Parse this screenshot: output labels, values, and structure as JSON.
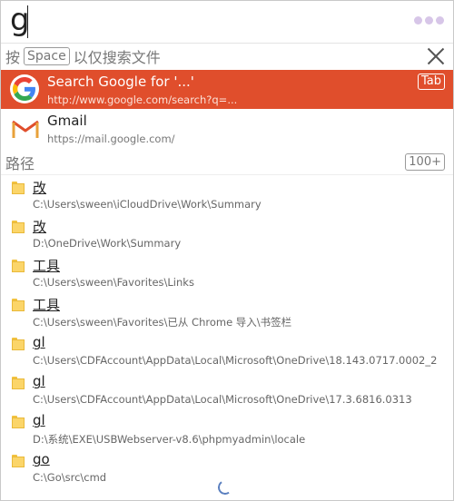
{
  "search": {
    "query": "g"
  },
  "hint": {
    "prefix": "按",
    "key": "Space",
    "suffix": "以仅搜索文件"
  },
  "results": [
    {
      "title": "Search Google for '...'",
      "url": "http://www.google.com/search?q=...",
      "shortcut": "Tab",
      "icon": "google-icon"
    },
    {
      "title": "Gmail",
      "url": "https://mail.google.com/",
      "icon": "gmail-icon"
    }
  ],
  "paths_section": {
    "title": "路径",
    "count": "100+"
  },
  "paths": [
    {
      "name": "改",
      "path": "C:\\Users\\sween\\iCloudDrive\\Work\\Summary"
    },
    {
      "name": "改",
      "path": "D:\\OneDrive\\Work\\Summary"
    },
    {
      "name": "工具",
      "path": "C:\\Users\\sween\\Favorites\\Links"
    },
    {
      "name": "工具",
      "path": "C:\\Users\\sween\\Favorites\\已从 Chrome 导入\\书签栏"
    },
    {
      "name": "gl",
      "path": "C:\\Users\\CDFAccount\\AppData\\Local\\Microsoft\\OneDrive\\18.143.0717.0002_2"
    },
    {
      "name": "gl",
      "path": "C:\\Users\\CDFAccount\\AppData\\Local\\Microsoft\\OneDrive\\17.3.6816.0313"
    },
    {
      "name": "gl",
      "path": "D:\\系统\\EXE\\USBWebserver-v8.6\\phpmyadmin\\locale"
    },
    {
      "name": "go",
      "path": "C:\\Go\\src\\cmd"
    }
  ],
  "colors": {
    "highlight": "#e04e2c",
    "folder": "#fbd569"
  }
}
